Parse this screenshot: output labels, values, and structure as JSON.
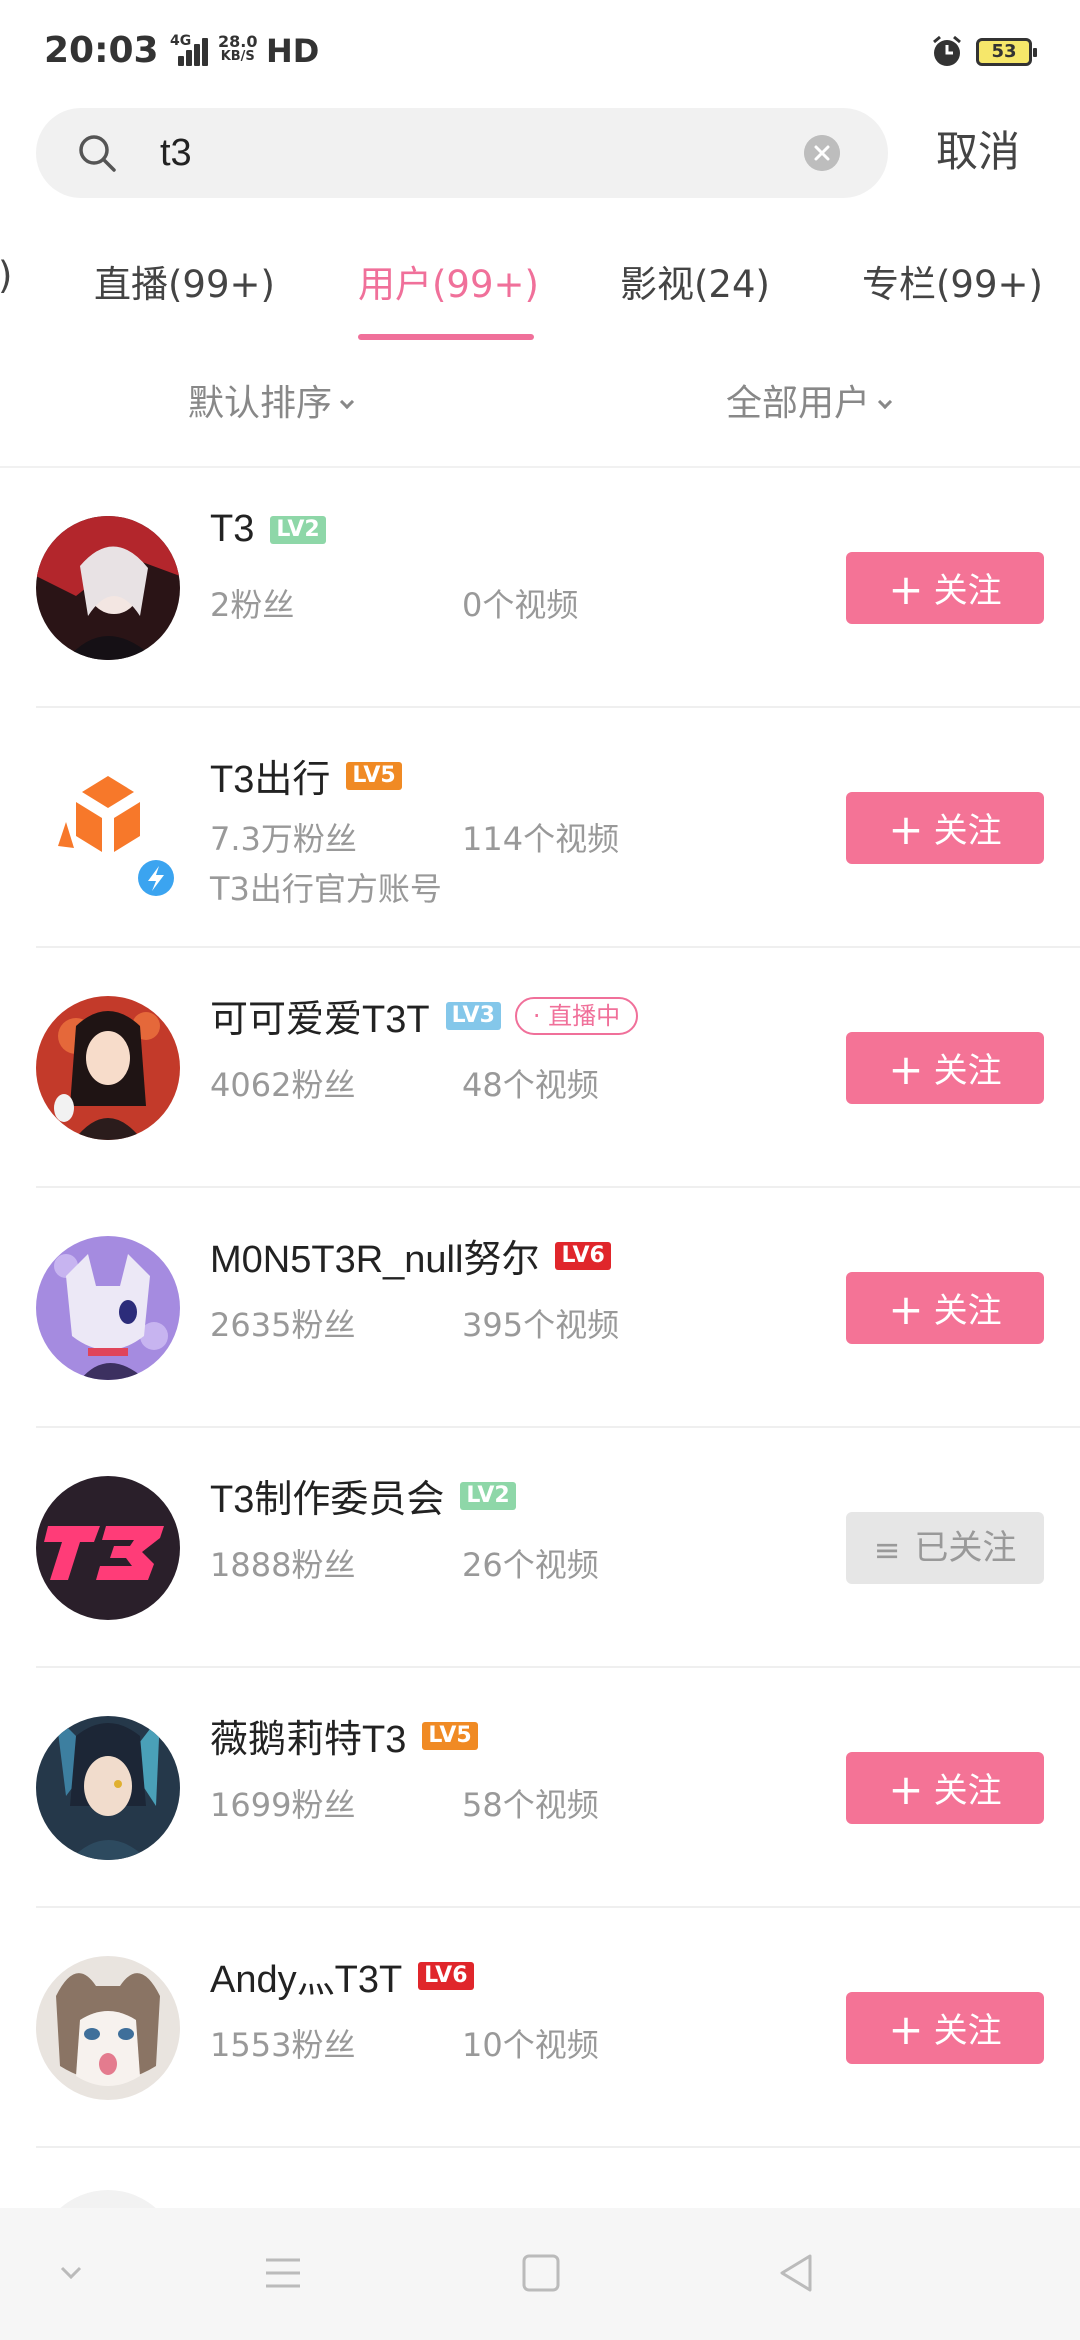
{
  "status_bar": {
    "time": "20:03",
    "network": "4G",
    "speed_value": "28.0",
    "speed_unit": "KB/S",
    "hd": "HD",
    "battery": "53"
  },
  "search": {
    "query": "t3",
    "cancel_label": "取消"
  },
  "tabs": [
    {
      "label": ")"
    },
    {
      "label": "直播(99+)"
    },
    {
      "label": "用户(99+)"
    },
    {
      "label": "影视(24)"
    },
    {
      "label": "专栏(99+)"
    }
  ],
  "filters": {
    "sort": "默认排序",
    "user_type": "全部用户"
  },
  "users": [
    {
      "name": "T3",
      "level": "LV2",
      "level_color": "#8ed7a8",
      "fans": "2粉丝",
      "videos": "0个视频",
      "follow_label": "关注"
    },
    {
      "name": "T3出行",
      "level": "LV5",
      "level_color": "#f08a24",
      "fans": "7.3万粉丝",
      "videos": "114个视频",
      "description": "T3出行官方账号",
      "follow_label": "关注"
    },
    {
      "name": "可可爱爱T3T",
      "level": "LV3",
      "level_color": "#84c7ea",
      "live_badge": "· 直播中",
      "fans": "4062粉丝",
      "videos": "48个视频",
      "follow_label": "关注"
    },
    {
      "name": "M0N5T3R_null努尔",
      "level": "LV6",
      "level_color": "#e0262b",
      "fans": "2635粉丝",
      "videos": "395个视频",
      "follow_label": "关注"
    },
    {
      "name": "T3制作委员会",
      "level": "LV2",
      "level_color": "#8ed7a8",
      "fans": "1888粉丝",
      "videos": "26个视频",
      "follow_label": "已关注"
    },
    {
      "name": "薇鹅莉特T3",
      "level": "LV5",
      "level_color": "#f08a24",
      "fans": "1699粉丝",
      "videos": "58个视频",
      "follow_label": "关注"
    },
    {
      "name": "Andy灬T3T",
      "level": "LV6",
      "level_color": "#e0262b",
      "fans": "1553粉丝",
      "videos": "10个视频",
      "follow_label": "关注"
    }
  ],
  "accent_color": "#f0709a"
}
